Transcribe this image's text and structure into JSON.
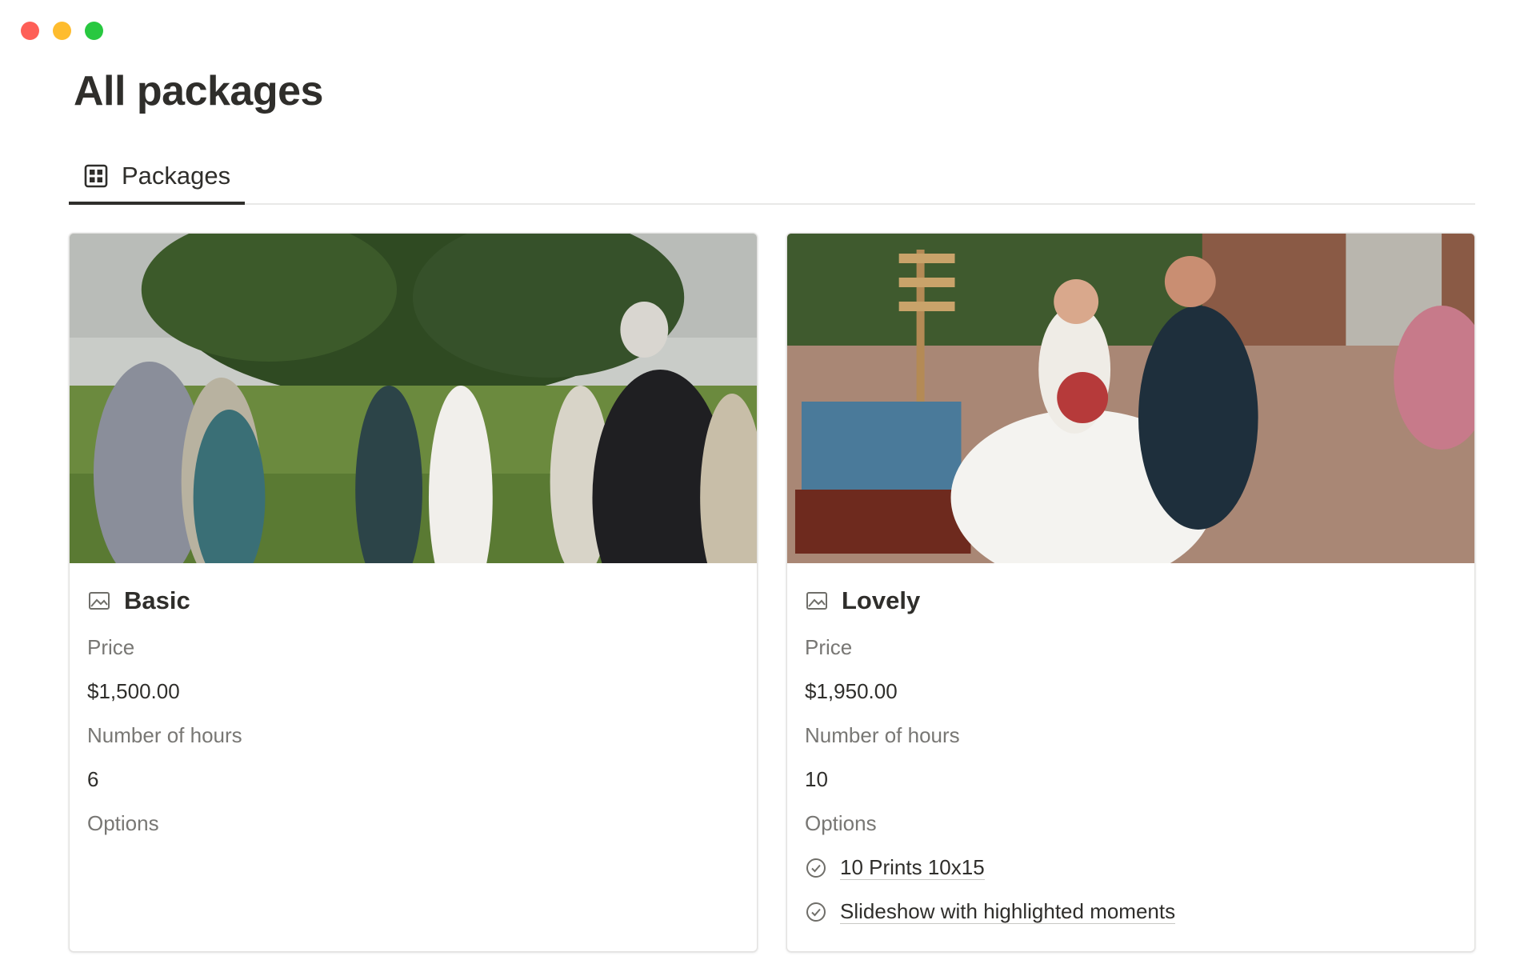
{
  "window": {
    "controls": [
      "close",
      "minimize",
      "zoom"
    ]
  },
  "page": {
    "title": "All packages"
  },
  "view_tabs": [
    {
      "label": "Packages",
      "icon": "table-grid-icon",
      "active": true
    }
  ],
  "cards": [
    {
      "name": "Basic",
      "cover": "wedding-recessional-photo",
      "properties": {
        "price_label": "Price",
        "price": "$1,500.00",
        "hours_label": "Number of hours",
        "hours": "6",
        "options_label": "Options",
        "options": []
      }
    },
    {
      "name": "Lovely",
      "cover": "bride-groom-seated-photo",
      "properties": {
        "price_label": "Price",
        "price": "$1,950.00",
        "hours_label": "Number of hours",
        "hours": "10",
        "options_label": "Options",
        "options": [
          "10 Prints 10x15",
          "Slideshow with highlighted moments"
        ]
      }
    }
  ],
  "colors": {
    "close": "#fe5f57",
    "minimize": "#febc2e",
    "zoom": "#28c840",
    "text": "#2f2e2b",
    "muted": "#787774"
  }
}
